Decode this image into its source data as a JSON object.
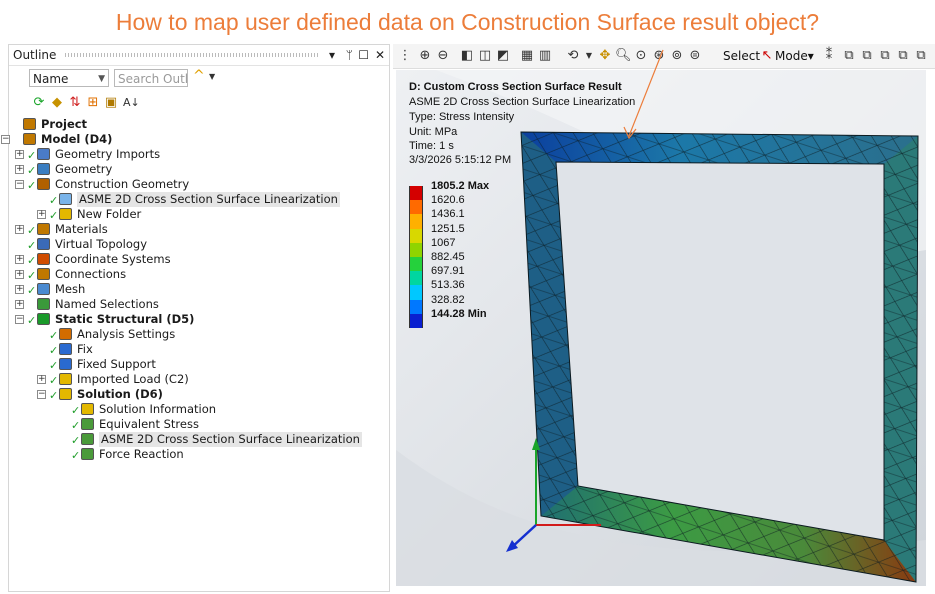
{
  "banner": "How to map user defined data on Construction Surface result object?",
  "outline": {
    "title": "Outline",
    "controls": [
      "▾",
      "📌",
      "☐",
      "✕"
    ],
    "name_filter": "Name",
    "search_placeholder": "Search Outlin"
  },
  "tree": [
    {
      "label": "Project",
      "bold": true
    },
    {
      "label": "Model (D4)",
      "bold": true
    },
    {
      "label": "Geometry Imports"
    },
    {
      "label": "Geometry"
    },
    {
      "label": "Construction Geometry"
    },
    {
      "label": "ASME 2D Cross Section Surface Linearization",
      "selected": true
    },
    {
      "label": "New Folder"
    },
    {
      "label": "Materials"
    },
    {
      "label": "Virtual Topology"
    },
    {
      "label": "Coordinate Systems"
    },
    {
      "label": "Connections"
    },
    {
      "label": "Mesh"
    },
    {
      "label": "Named Selections"
    },
    {
      "label": "Static Structural (D5)",
      "bold": true
    },
    {
      "label": "Analysis Settings"
    },
    {
      "label": "Fix"
    },
    {
      "label": "Fixed Support"
    },
    {
      "label": "Imported Load (C2)"
    },
    {
      "label": "Solution (D6)",
      "bold": true
    },
    {
      "label": "Solution Information"
    },
    {
      "label": "Equivalent Stress"
    },
    {
      "label": "ASME 2D Cross Section Surface Linearization",
      "selected": true
    },
    {
      "label": "Force Reaction"
    }
  ],
  "viewer_toolbar": {
    "select_label": "Select",
    "mode_label": "Mode▾"
  },
  "result": {
    "title": "D: Custom Cross Section Surface Result",
    "subtitle": "ASME 2D Cross Section Surface Linearization",
    "type": "Type: Stress Intensity",
    "unit": "Unit: MPa",
    "time": "Time: 1 s",
    "date": "3/3/2026 5:15:12 PM"
  },
  "legend": {
    "max_label": "1805.2 Max",
    "values": [
      "1620.6",
      "1436.1",
      "1251.5",
      "1067",
      "882.45",
      "697.91",
      "513.36",
      "328.82"
    ],
    "min_label": "144.28 Min",
    "colors": [
      "#d40000",
      "#ff6a00",
      "#ffb000",
      "#d8d800",
      "#8fd400",
      "#25d13c",
      "#00d6a0",
      "#00c8ff",
      "#0078ff",
      "#0a1fd0"
    ]
  }
}
